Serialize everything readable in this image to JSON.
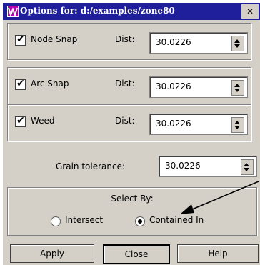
{
  "window": {
    "title": "Options for: d:/examples/zone80",
    "close_label": "✕"
  },
  "groups": [
    {
      "label": "Node Snap",
      "dist_label": "Dist:",
      "value": "30.0226",
      "checked": true
    },
    {
      "label": "Arc Snap",
      "dist_label": "Dist:",
      "value": "30.0226",
      "checked": true
    },
    {
      "label": "Weed",
      "dist_label": "Dist:",
      "value": "30.0226",
      "checked": true
    }
  ],
  "grain": {
    "label": "Grain tolerance:",
    "value": "30.0226"
  },
  "select_by": {
    "title": "Select By:",
    "options": [
      {
        "label": "Intersect",
        "selected": false
      },
      {
        "label": "Contained In",
        "selected": true
      }
    ]
  },
  "buttons": {
    "apply": "Apply",
    "close": "Close",
    "help": "Help"
  },
  "colors": {
    "dialog_bg": "#d4d0c8",
    "titlebar": "#1f1f9c"
  }
}
